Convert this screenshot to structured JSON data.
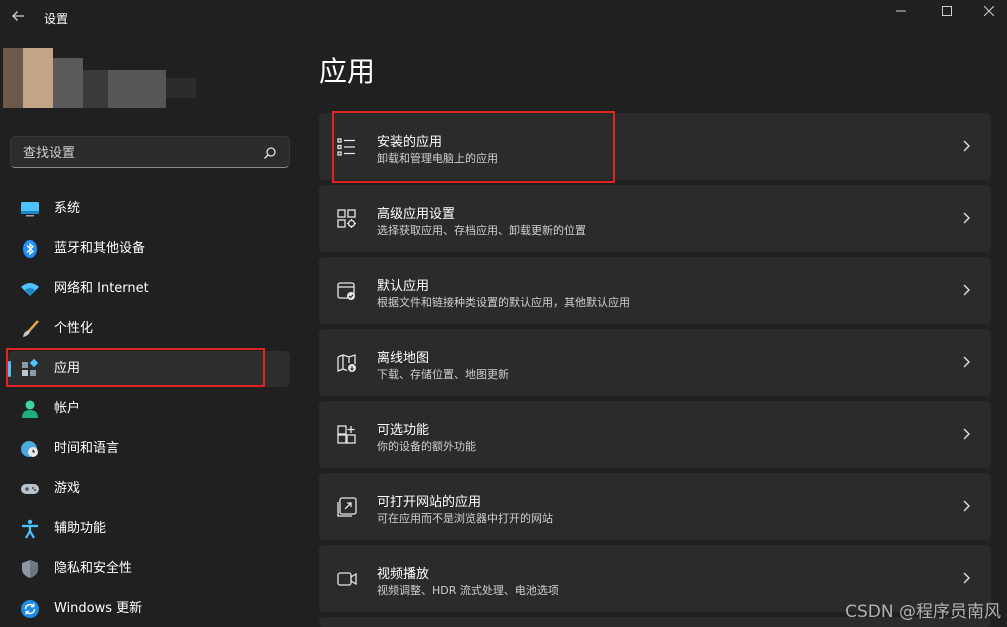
{
  "window": {
    "title": "设置"
  },
  "search": {
    "placeholder": "查找设置"
  },
  "sidebar": {
    "items": [
      {
        "label": "系统",
        "icon": "monitor-icon"
      },
      {
        "label": "蓝牙和其他设备",
        "icon": "bluetooth-icon"
      },
      {
        "label": "网络和 Internet",
        "icon": "wifi-icon"
      },
      {
        "label": "个性化",
        "icon": "paintbrush-icon"
      },
      {
        "label": "应用",
        "icon": "apps-icon",
        "selected": true
      },
      {
        "label": "帐户",
        "icon": "person-icon"
      },
      {
        "label": "时间和语言",
        "icon": "globe-clock-icon"
      },
      {
        "label": "游戏",
        "icon": "gamepad-icon"
      },
      {
        "label": "辅助功能",
        "icon": "accessibility-icon"
      },
      {
        "label": "隐私和安全性",
        "icon": "shield-icon"
      },
      {
        "label": "Windows 更新",
        "icon": "update-icon"
      }
    ]
  },
  "main": {
    "title": "应用",
    "cards": [
      {
        "title": "安装的应用",
        "subtitle": "卸载和管理电脑上的应用",
        "icon": "list-icon"
      },
      {
        "title": "高级应用设置",
        "subtitle": "选择获取应用、存档应用、卸载更新的位置",
        "icon": "advanced-apps-icon"
      },
      {
        "title": "默认应用",
        "subtitle": "根据文件和链接种类设置的默认应用，其他默认应用",
        "icon": "default-apps-icon"
      },
      {
        "title": "离线地图",
        "subtitle": "下载、存储位置、地图更新",
        "icon": "offline-map-icon"
      },
      {
        "title": "可选功能",
        "subtitle": "你的设备的额外功能",
        "icon": "optional-features-icon"
      },
      {
        "title": "可打开网站的应用",
        "subtitle": "可在应用而不是浏览器中打开的网站",
        "icon": "web-apps-icon"
      },
      {
        "title": "视频播放",
        "subtitle": "视频调整、HDR 流式处理、电池选项",
        "icon": "video-icon"
      }
    ]
  },
  "watermark": "CSDN @程序员南风",
  "colors": {
    "background": "#202020",
    "card": "#2b2b2b",
    "accent": "#4cc2ff",
    "highlight": "#e02424"
  }
}
